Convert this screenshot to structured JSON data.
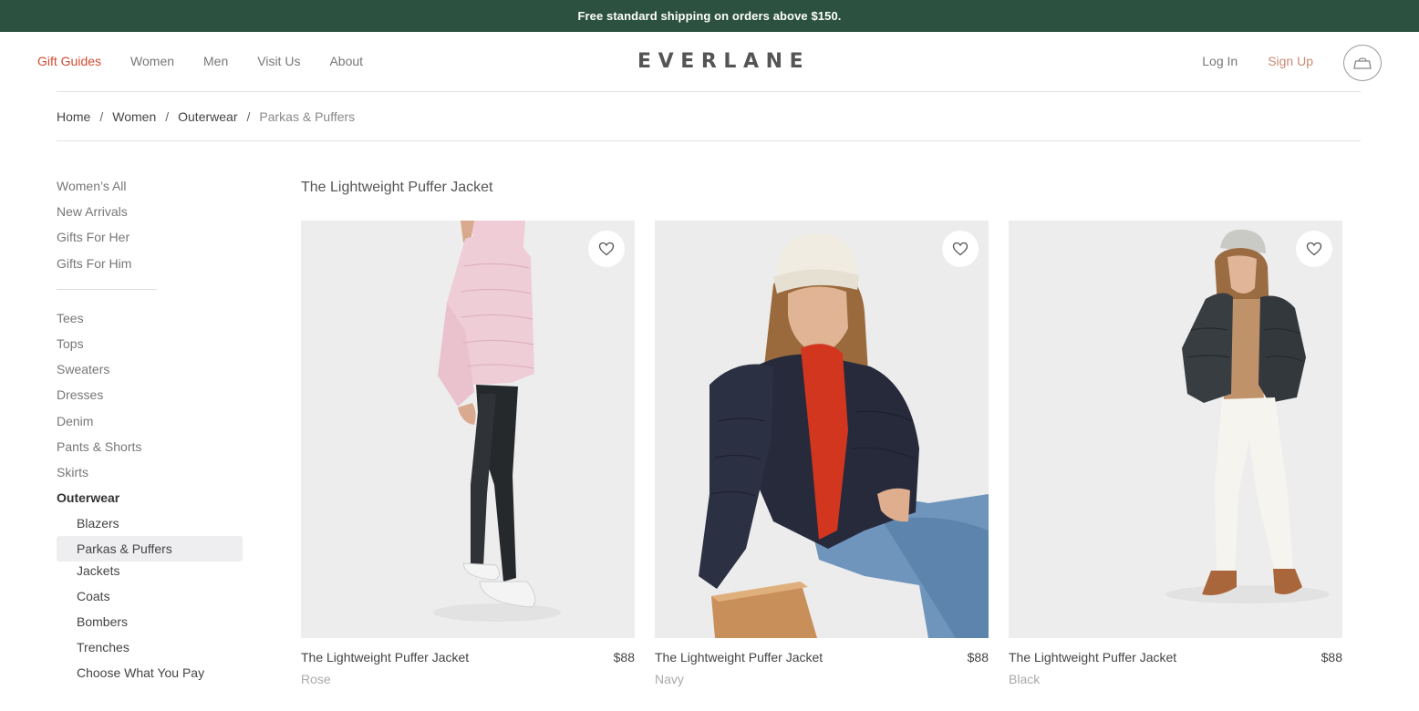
{
  "promo": {
    "text": "Free standard shipping on orders above $150."
  },
  "nav": {
    "left": [
      "Gift Guides",
      "Women",
      "Men",
      "Visit Us",
      "About"
    ],
    "logo": "EVERLANE",
    "login": "Log In",
    "signup": "Sign Up"
  },
  "breadcrumb": {
    "home": "Home",
    "women": "Women",
    "outerwear": "Outerwear",
    "current": "Parkas & Puffers",
    "sep": "/"
  },
  "sidebar": {
    "top": [
      "Women’s All",
      "New Arrivals",
      "Gifts For Her",
      "Gifts For Him"
    ],
    "categories": [
      "Tees",
      "Tops",
      "Sweaters",
      "Dresses",
      "Denim",
      "Pants & Shorts",
      "Skirts"
    ],
    "outerwear": "Outerwear",
    "sub": [
      "Blazers",
      "Parkas & Puffers",
      "Jackets",
      "Coats",
      "Bombers",
      "Trenches",
      "Choose What You Pay"
    ]
  },
  "section_title": "The Lightweight Puffer Jacket",
  "products": [
    {
      "name": "The Lightweight Puffer Jacket",
      "price": "$88",
      "color": "Rose"
    },
    {
      "name": "The Lightweight Puffer Jacket",
      "price": "$88",
      "color": "Navy"
    },
    {
      "name": "The Lightweight Puffer Jacket",
      "price": "$88",
      "color": "Black"
    }
  ],
  "colors": {
    "promo_bg": "#2c5140",
    "accent_red": "#d14a32",
    "signup": "#c98a73"
  }
}
